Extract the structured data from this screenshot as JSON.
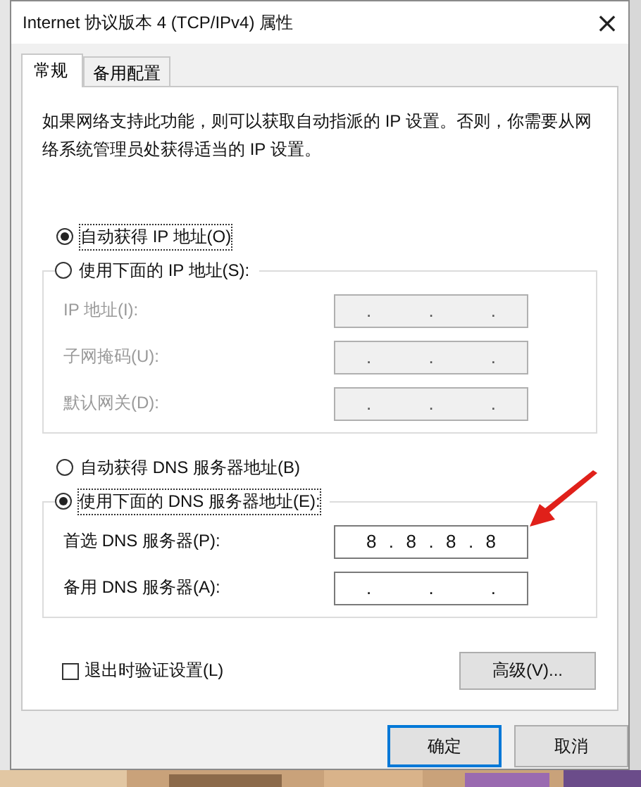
{
  "window": {
    "title": "Internet 协议版本 4 (TCP/IPv4) 属性",
    "close": "×"
  },
  "tabs": [
    {
      "label": "常规",
      "selected": true
    },
    {
      "label": "备用配置",
      "selected": false
    }
  ],
  "description": "如果网络支持此功能，则可以获取自动指派的 IP 设置。否则，你需要从网络系统管理员处获得适当的 IP 设置。",
  "ip_options": [
    {
      "label": "自动获得 IP 地址(O)",
      "selected": true
    },
    {
      "label": "使用下面的 IP 地址(S):",
      "selected": false
    }
  ],
  "ip_fields": [
    {
      "label": "IP 地址(I):",
      "value": ". . .",
      "disabled": true
    },
    {
      "label": "子网掩码(U):",
      "value": ". . .",
      "disabled": true
    },
    {
      "label": "默认网关(D):",
      "value": ". . .",
      "disabled": true
    }
  ],
  "dns_options": [
    {
      "label": "自动获得 DNS 服务器地址(B)",
      "selected": false
    },
    {
      "label": "使用下面的 DNS 服务器地址(E):",
      "selected": true
    }
  ],
  "dns_fields": [
    {
      "label": "首选 DNS 服务器(P):",
      "value": "8 . 8 . 8 . 8",
      "disabled": false
    },
    {
      "label": "备用 DNS 服务器(A):",
      "value": ". . .",
      "disabled": false
    }
  ],
  "validate": {
    "label": "退出时验证设置(L)",
    "checked": false
  },
  "advanced_button": "高级(V)...",
  "buttons": [
    {
      "label": "确定",
      "default": true
    },
    {
      "label": "取消",
      "default": false
    }
  ]
}
